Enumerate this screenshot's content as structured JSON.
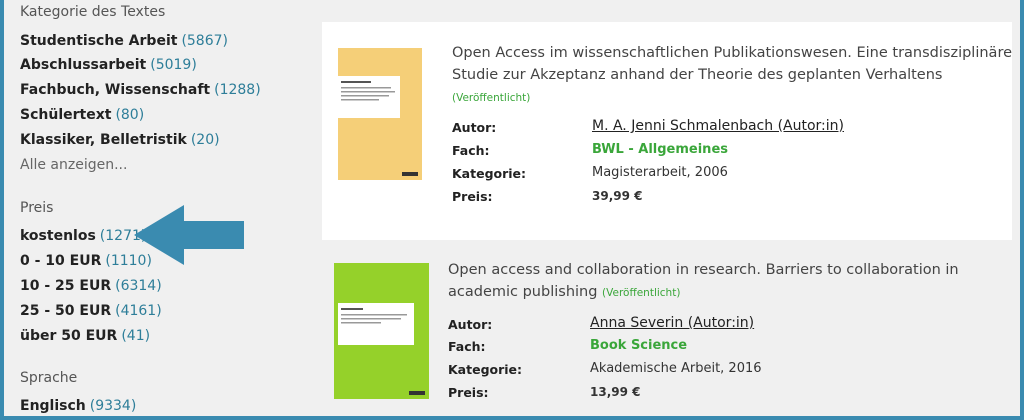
{
  "sidebar": {
    "category": {
      "title": "Kategorie des Textes",
      "items": [
        {
          "label": "Studentische Arbeit",
          "count": "(5867)"
        },
        {
          "label": "Abschlussarbeit",
          "count": "(5019)"
        },
        {
          "label": "Fachbuch, Wissenschaft",
          "count": "(1288)"
        },
        {
          "label": "Schülertext",
          "count": "(80)"
        },
        {
          "label": "Klassiker, Belletristik",
          "count": "(20)"
        }
      ],
      "show_all": "Alle anzeigen..."
    },
    "price": {
      "title": "Preis",
      "items": [
        {
          "label": "kostenlos",
          "count": "(1271)"
        },
        {
          "label": "0 - 10 EUR",
          "count": "(1110)"
        },
        {
          "label": "10 - 25 EUR",
          "count": "(6314)"
        },
        {
          "label": "25 - 50 EUR",
          "count": "(4161)"
        },
        {
          "label": "über 50 EUR",
          "count": "(41)"
        }
      ]
    },
    "language": {
      "title": "Sprache",
      "items": [
        {
          "label": "Englisch",
          "count": "(9334)"
        }
      ]
    }
  },
  "results": [
    {
      "title": "Open Access im wissenschaftlichen Publikationswesen. Eine transdisziplinäre Studie zur Akzeptanz anhand der Theorie des geplanten Verhaltens",
      "status": "(Veröffentlicht)",
      "labels": {
        "author": "Autor:",
        "subject": "Fach:",
        "category": "Kategorie:",
        "price": "Preis:"
      },
      "author": "M. A. Jenni Schmalenbach (Autor:in)",
      "subject": "BWL - Allgemeines",
      "category": "Magisterarbeit, 2006",
      "price": "39,99 €",
      "cover_color": "#f5cf78"
    },
    {
      "title": "Open access and collaboration in research. Barriers to collaboration in academic publishing",
      "status": "(Veröffentlicht)",
      "labels": {
        "author": "Autor:",
        "subject": "Fach:",
        "category": "Kategorie:",
        "price": "Preis:"
      },
      "author": "Anna Severin (Autor:in)",
      "subject": "Book Science",
      "category": "Akademische Arbeit, 2016",
      "price": "13,99 €",
      "cover_color": "#95d12a"
    }
  ],
  "colors": {
    "frame_border": "#3a8bb0",
    "background": "#f0f0f0",
    "count": "#2e7e99",
    "status_green": "#3aa63a",
    "arrow": "#3a8bb0"
  }
}
